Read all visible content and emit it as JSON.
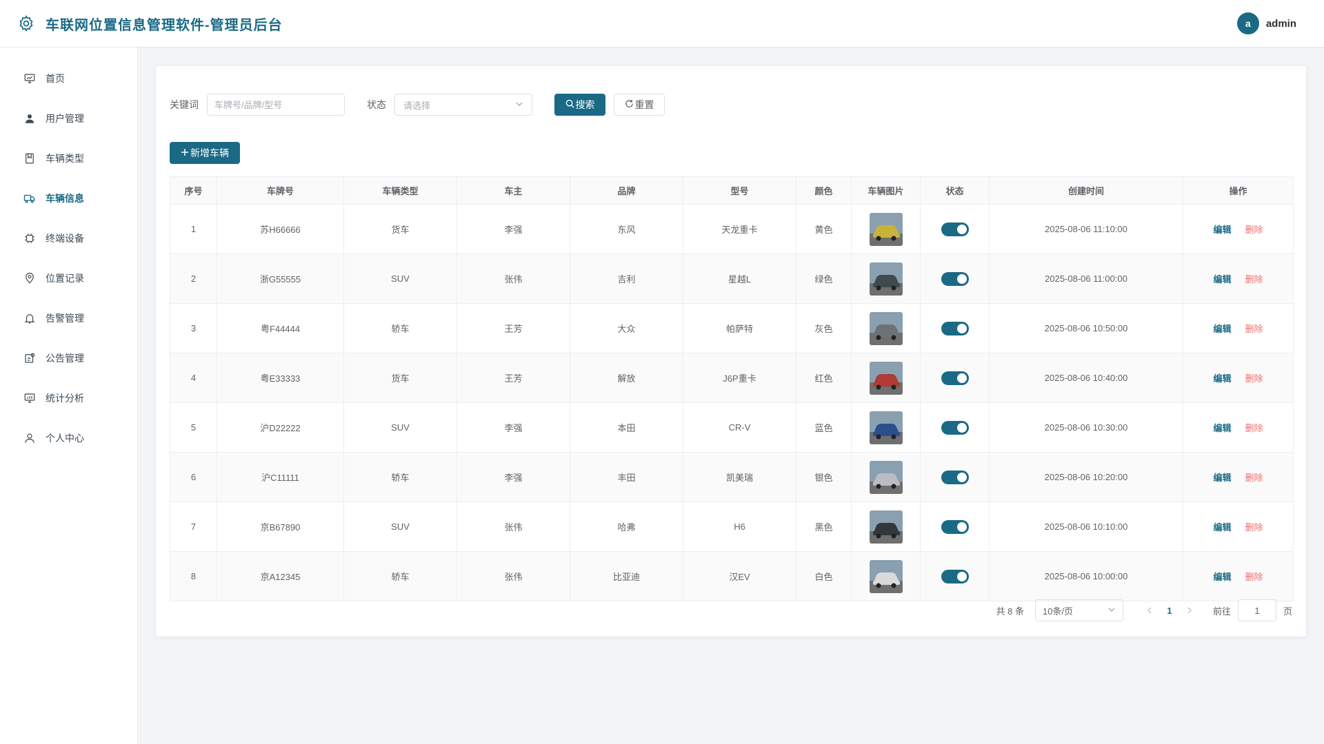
{
  "header": {
    "title": "车联网位置信息管理软件-管理员后台",
    "avatar_letter": "a",
    "username": "admin"
  },
  "sidebar": {
    "items": [
      {
        "label": "首页",
        "icon": "dashboard-icon"
      },
      {
        "label": "用户管理",
        "icon": "user-icon"
      },
      {
        "label": "车辆类型",
        "icon": "vehicle-type-icon"
      },
      {
        "label": "车辆信息",
        "icon": "truck-icon",
        "active": true
      },
      {
        "label": "终端设备",
        "icon": "chip-icon"
      },
      {
        "label": "位置记录",
        "icon": "location-pin-icon"
      },
      {
        "label": "告警管理",
        "icon": "bell-icon"
      },
      {
        "label": "公告管理",
        "icon": "notice-icon"
      },
      {
        "label": "统计分析",
        "icon": "chart-icon"
      },
      {
        "label": "个人中心",
        "icon": "profile-icon"
      }
    ]
  },
  "filters": {
    "keyword_label": "关键词",
    "keyword_placeholder": "车牌号/品牌/型号",
    "status_label": "状态",
    "status_placeholder": "请选择",
    "search_label": "搜索",
    "reset_label": "重置"
  },
  "toolbar": {
    "add_label": "新增车辆"
  },
  "table": {
    "columns": [
      "序号",
      "车牌号",
      "车辆类型",
      "车主",
      "品牌",
      "型号",
      "颜色",
      "车辆图片",
      "状态",
      "创建时间",
      "操作"
    ],
    "edit_label": "编辑",
    "delete_label": "删除",
    "rows": [
      {
        "idx": "1",
        "plate": "苏H66666",
        "type": "货车",
        "owner": "李强",
        "brand": "东风",
        "model": "天龙重卡",
        "color": "黄色",
        "img_color": "#c9b23a",
        "status": true,
        "created": "2025-08-06 11:10:00"
      },
      {
        "idx": "2",
        "plate": "浙G55555",
        "type": "SUV",
        "owner": "张伟",
        "brand": "吉利",
        "model": "星越L",
        "color": "绿色",
        "img_color": "#3f4a4f",
        "status": true,
        "created": "2025-08-06 11:00:00"
      },
      {
        "idx": "3",
        "plate": "粤F44444",
        "type": "轿车",
        "owner": "王芳",
        "brand": "大众",
        "model": "帕萨特",
        "color": "灰色",
        "img_color": "#6d7277",
        "status": true,
        "created": "2025-08-06 10:50:00"
      },
      {
        "idx": "4",
        "plate": "粤E33333",
        "type": "货车",
        "owner": "王芳",
        "brand": "解放",
        "model": "J6P重卡",
        "color": "红色",
        "img_color": "#b03a36",
        "status": true,
        "created": "2025-08-06 10:40:00"
      },
      {
        "idx": "5",
        "plate": "沪D22222",
        "type": "SUV",
        "owner": "李强",
        "brand": "本田",
        "model": "CR-V",
        "color": "蓝色",
        "img_color": "#2b4f8c",
        "status": true,
        "created": "2025-08-06 10:30:00"
      },
      {
        "idx": "6",
        "plate": "沪C11111",
        "type": "轿车",
        "owner": "李强",
        "brand": "丰田",
        "model": "凯美瑞",
        "color": "银色",
        "img_color": "#b9bcc0",
        "status": true,
        "created": "2025-08-06 10:20:00"
      },
      {
        "idx": "7",
        "plate": "京B67890",
        "type": "SUV",
        "owner": "张伟",
        "brand": "哈弗",
        "model": "H6",
        "color": "黑色",
        "img_color": "#33373b",
        "status": true,
        "created": "2025-08-06 10:10:00"
      },
      {
        "idx": "8",
        "plate": "京A12345",
        "type": "轿车",
        "owner": "张伟",
        "brand": "比亚迪",
        "model": "汉EV",
        "color": "白色",
        "img_color": "#d8dadc",
        "status": true,
        "created": "2025-08-06 10:00:00"
      }
    ]
  },
  "pagination": {
    "total_text": "共 8 条",
    "page_size": "10条/页",
    "current_page": "1",
    "goto_label": "前往",
    "goto_value": "1",
    "page_suffix": "页"
  },
  "colors": {
    "primary": "#1a6a86",
    "danger": "#f56c6c"
  }
}
